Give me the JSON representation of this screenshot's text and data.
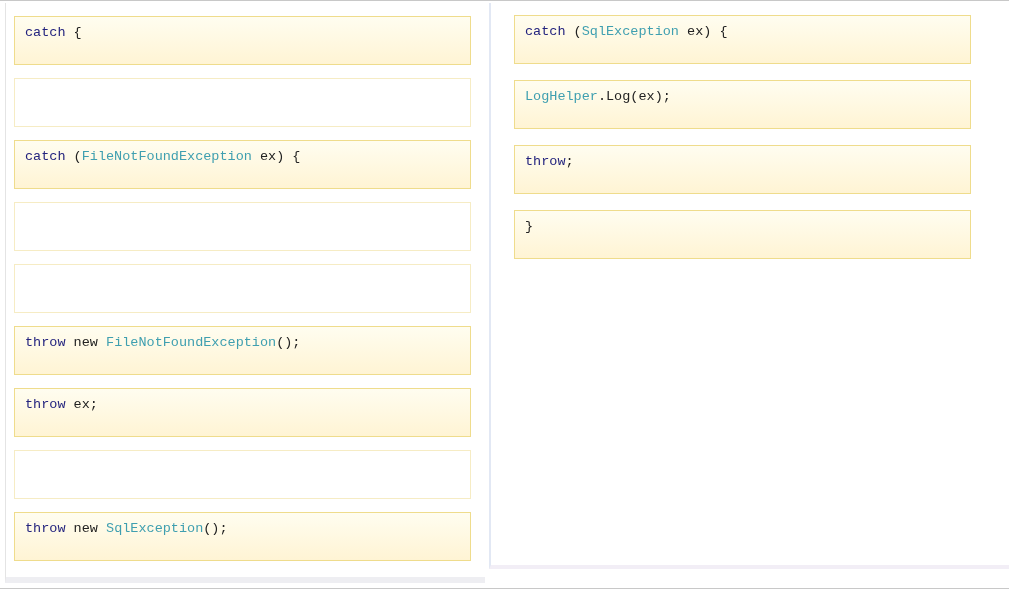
{
  "source_panel": {
    "slots": [
      {
        "kind": "code",
        "tokens": [
          {
            "kind": "keyword",
            "text": "catch"
          },
          {
            "kind": "plain",
            "text": " {"
          }
        ]
      },
      {
        "kind": "empty"
      },
      {
        "kind": "code",
        "tokens": [
          {
            "kind": "keyword",
            "text": "catch"
          },
          {
            "kind": "plain",
            "text": " ("
          },
          {
            "kind": "type",
            "text": "FileNotFoundException"
          },
          {
            "kind": "plain",
            "text": " ex) {"
          }
        ]
      },
      {
        "kind": "empty"
      },
      {
        "kind": "empty"
      },
      {
        "kind": "code",
        "tokens": [
          {
            "kind": "keyword",
            "text": "throw"
          },
          {
            "kind": "plain",
            "text": " new "
          },
          {
            "kind": "type",
            "text": "FileNotFoundException"
          },
          {
            "kind": "plain",
            "text": "();"
          }
        ]
      },
      {
        "kind": "code",
        "tokens": [
          {
            "kind": "keyword",
            "text": "throw"
          },
          {
            "kind": "plain",
            "text": " ex;"
          }
        ]
      },
      {
        "kind": "empty"
      },
      {
        "kind": "code",
        "tokens": [
          {
            "kind": "keyword",
            "text": "throw"
          },
          {
            "kind": "plain",
            "text": " new "
          },
          {
            "kind": "type",
            "text": "SqlException"
          },
          {
            "kind": "plain",
            "text": "();"
          }
        ]
      }
    ]
  },
  "answer_panel": {
    "slots": [
      {
        "kind": "code",
        "tokens": [
          {
            "kind": "keyword",
            "text": "catch"
          },
          {
            "kind": "plain",
            "text": " ("
          },
          {
            "kind": "type",
            "text": "SqlException"
          },
          {
            "kind": "plain",
            "text": " ex) {"
          }
        ]
      },
      {
        "kind": "code",
        "tokens": [
          {
            "kind": "type",
            "text": "LogHelper"
          },
          {
            "kind": "plain",
            "text": ".Log(ex);"
          }
        ]
      },
      {
        "kind": "code",
        "tokens": [
          {
            "kind": "keyword",
            "text": "throw"
          },
          {
            "kind": "plain",
            "text": ";"
          }
        ]
      },
      {
        "kind": "code",
        "tokens": [
          {
            "kind": "plain",
            "text": "}"
          }
        ]
      }
    ]
  }
}
